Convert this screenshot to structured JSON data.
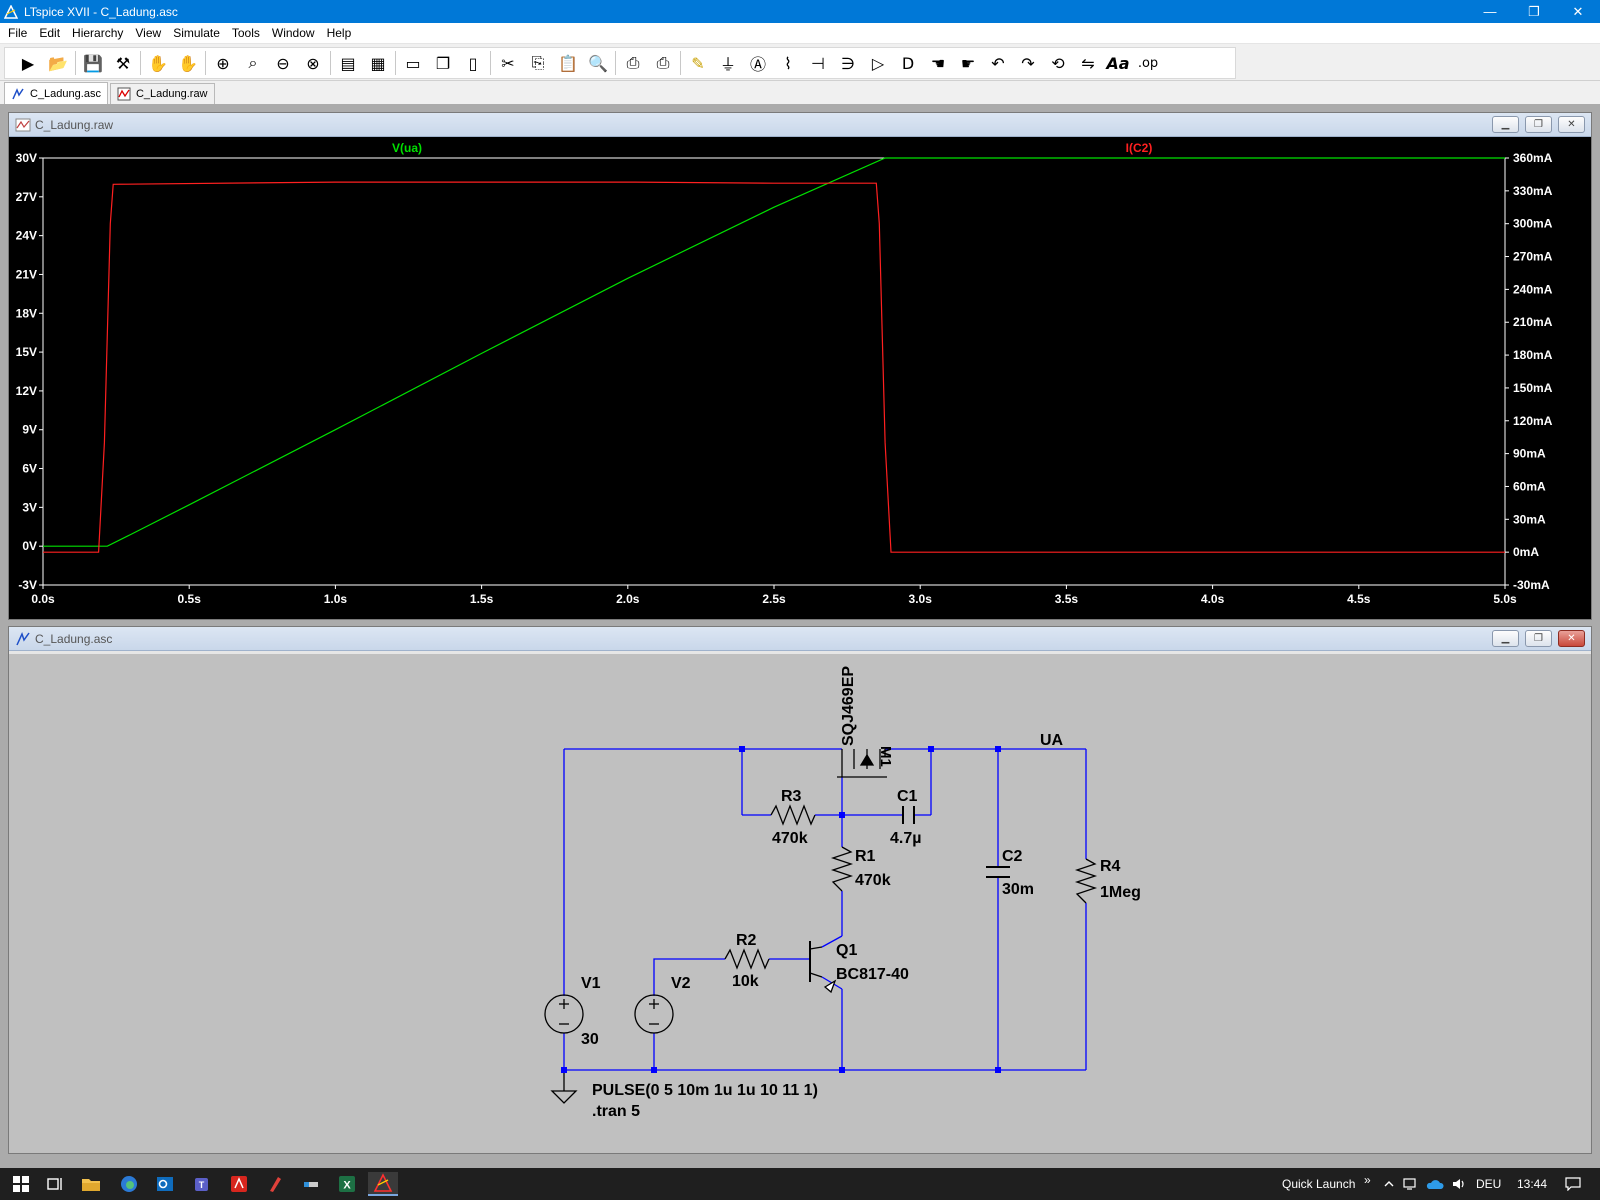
{
  "window": {
    "title": "LTspice XVII - C_Ladung.asc",
    "minimize_glyph": "—",
    "maximize_glyph": "❐",
    "close_glyph": "✕"
  },
  "menu": [
    "File",
    "Edit",
    "Hierarchy",
    "View",
    "Simulate",
    "Tools",
    "Window",
    "Help"
  ],
  "toolbar": {
    "buttons": [
      "run-icon",
      "open-icon",
      "save-icon",
      "control-panel-icon",
      "halt-icon",
      "pan-icon",
      "zoom-in-icon",
      "zoom-to-fit-icon",
      "zoom-out-icon",
      "zoom-cancel-icon",
      "autorange-icon",
      "mark-icon",
      "tile-horizontal-icon",
      "cascade-icon",
      "tile-vertical-icon",
      "cut-icon",
      "copy-icon",
      "paste-icon",
      "find-icon",
      "print-setup-icon",
      "print-icon",
      "wire-icon",
      "ground-icon",
      "label-icon",
      "resistor-icon",
      "capacitor-icon",
      "inductor-icon",
      "diode-icon",
      "component-icon",
      "move-icon",
      "drag-icon",
      "undo-icon",
      "redo-icon",
      "rotate-icon",
      "mirror-icon",
      "text-icon",
      "spice-directive-icon"
    ],
    "text_label": "Aa",
    "spice_label": ".op"
  },
  "tabs": [
    {
      "label": "C_Ladung.asc",
      "active": true
    },
    {
      "label": "C_Ladung.raw",
      "active": false
    }
  ],
  "wave": {
    "title": "C_Ladung.raw",
    "trace_left_label": "V(ua)",
    "trace_right_label": "I(C2)",
    "trace_left_color": "#00e000",
    "trace_right_color": "#ff2020",
    "left_ticks": [
      "30V",
      "27V",
      "24V",
      "21V",
      "18V",
      "15V",
      "12V",
      "9V",
      "6V",
      "3V",
      "0V",
      "-3V"
    ],
    "right_ticks": [
      "360mA",
      "330mA",
      "300mA",
      "270mA",
      "240mA",
      "210mA",
      "180mA",
      "150mA",
      "120mA",
      "90mA",
      "60mA",
      "30mA",
      "0mA",
      "-30mA"
    ],
    "x_ticks": [
      "0.0s",
      "0.5s",
      "1.0s",
      "1.5s",
      "2.0s",
      "2.5s",
      "3.0s",
      "3.5s",
      "4.0s",
      "4.5s",
      "5.0s"
    ]
  },
  "chart_data": {
    "type": "line",
    "x_range": [
      0,
      5
    ],
    "y_left_range": [
      -3,
      30
    ],
    "y_right_range": [
      -30,
      360
    ],
    "series": [
      {
        "name": "V(ua)",
        "axis": "left",
        "unit": "V",
        "x": [
          0,
          0.22,
          0.3,
          0.5,
          1.0,
          1.5,
          2.0,
          2.5,
          2.88,
          5.0
        ],
        "y": [
          0,
          0,
          0.9,
          3.2,
          9.0,
          14.9,
          20.7,
          26.2,
          30.0,
          30.0
        ]
      },
      {
        "name": "I(C2)",
        "axis": "right",
        "unit": "mA",
        "x": [
          0,
          0.19,
          0.21,
          0.23,
          0.24,
          1.0,
          2.0,
          2.5,
          2.85,
          2.86,
          2.88,
          2.9,
          5.0
        ],
        "y": [
          0,
          0,
          100,
          300,
          336,
          338,
          338,
          337,
          337,
          300,
          100,
          0,
          0
        ]
      }
    ]
  },
  "schematic": {
    "title": "C_Ladung.asc",
    "wire_color": "#0000ff",
    "net_label": "UA",
    "components": {
      "m1_model": "SQJ469EP",
      "m1_name": "M1",
      "r3_name": "R3",
      "r3_value": "470k",
      "c1_name": "C1",
      "c1_value": "4.7µ",
      "r1_name": "R1",
      "r1_value": "470k",
      "c2_name": "C2",
      "c2_value": "30m",
      "r4_name": "R4",
      "r4_value": "1Meg",
      "r2_name": "R2",
      "r2_value": "10k",
      "q1_name": "Q1",
      "q1_model": "BC817-40",
      "v1_name": "V1",
      "v1_value": "30",
      "v2_name": "V2"
    },
    "directives": {
      "pulse": "PULSE(0 5 10m 1u 1u 10 11 1)",
      "tran": ".tran 5"
    }
  },
  "taskbar": {
    "quick_launch": "Quick Launch",
    "chevron": "»",
    "language": "DEU",
    "time": "13:44"
  }
}
